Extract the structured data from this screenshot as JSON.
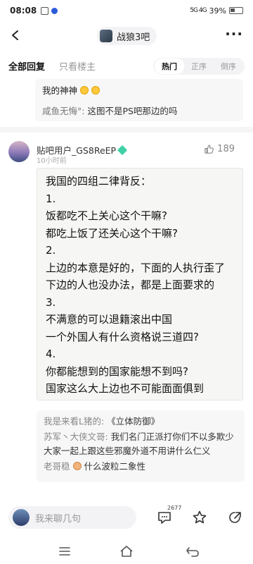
{
  "status_bar": {
    "time": "08:08",
    "signal_labels": "5G 4G",
    "battery": "39%"
  },
  "nav": {
    "back_icon": "chevron-left-icon",
    "forum_name": "战狼3吧",
    "more_label": "···"
  },
  "filters": {
    "all_replies": "全部回复",
    "owner_only": "只看楼主",
    "sort_options": [
      "热门",
      "正序",
      "倒序"
    ],
    "active_sort": "热门"
  },
  "previous_comment": {
    "line1": "我的神神",
    "reply_user": "咸鱼无悔°:",
    "reply_text": "这图不是PS吧那边的吗"
  },
  "post": {
    "username": "贴吧用户_GS8ReEP",
    "time": "10小时前",
    "like_count": "189",
    "image_lines": [
      "我国的四组二律背反：",
      "1.",
      "饭都吃不上关心这个干嘛?",
      "都吃上饭了还关心这个干嘛?",
      "2.",
      "上边的本意是好的，下面的人执行歪了",
      "下边的人也没办法，都是上面要求的",
      "3.",
      "不满意的可以退籍滚出中国",
      "一个外国人有什么资格说三道四?",
      "4.",
      "你都能想到的国家能想不到吗?",
      "国家这么大上边也不可能面面俱到"
    ]
  },
  "replies": [
    {
      "user": "我是来看L猪的:",
      "text": "《立体防御》"
    },
    {
      "user": "苏军丶大侠文哥:",
      "text": "我们名门正派打你们不以多欺少 大家一起上跟这些邪魔外道不用讲什么仁义"
    },
    {
      "user": "老哥稳",
      "text": "什么波粒二象性"
    }
  ],
  "bottom_bar": {
    "input_placeholder": "我来聊几句",
    "comment_count": "2677"
  },
  "colors": {
    "accent": "#2a5bd7",
    "gem": "#3fd0a8",
    "background": "#ffffff",
    "block_bg": "#f7f7f8"
  }
}
